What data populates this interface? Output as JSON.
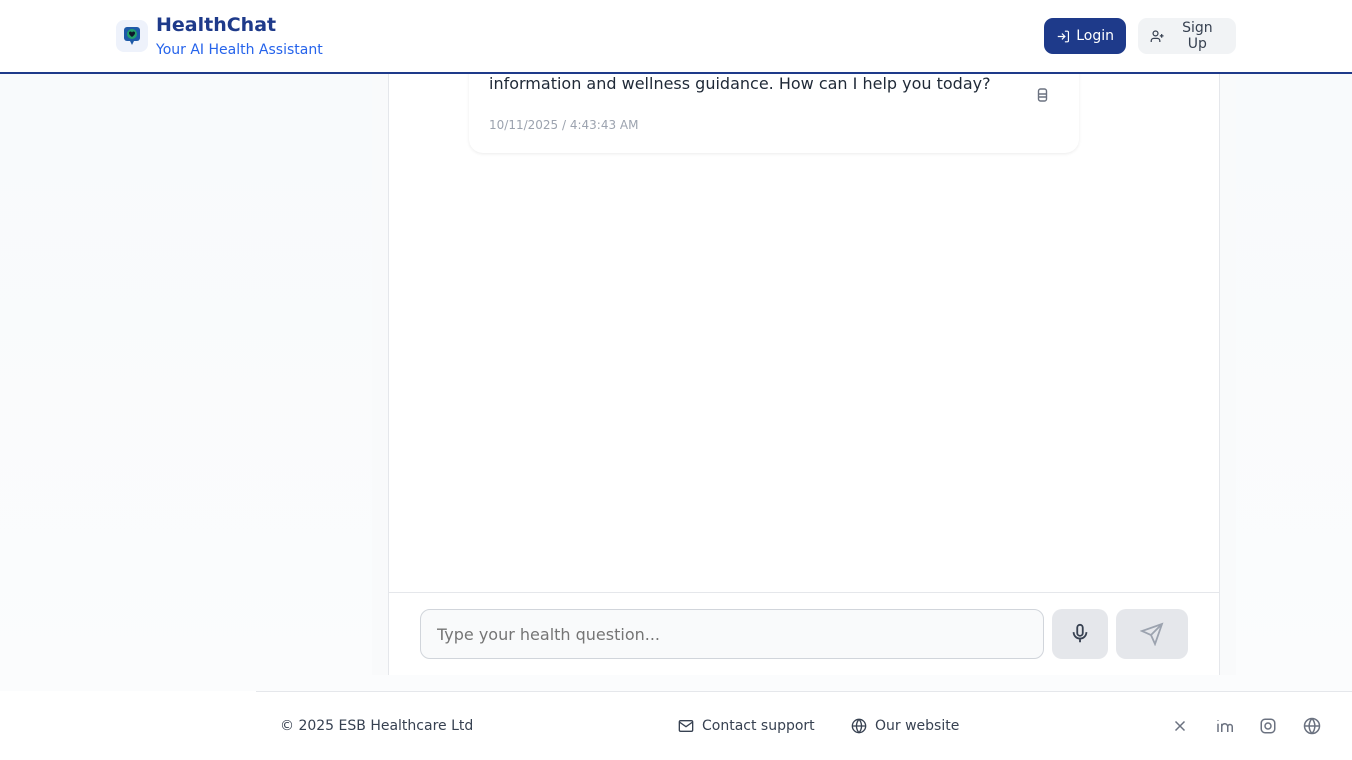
{
  "header": {
    "title": "HealthChat",
    "subtitle": "Your AI Health Assistant",
    "login_label": "Login",
    "signup_label": "Sign Up"
  },
  "chat": {
    "messages": [
      {
        "text": "information and wellness guidance. How can I help you today?",
        "timestamp": "10/11/2025 / 4:43:43 AM"
      }
    ],
    "input_placeholder": "Type your health question..."
  },
  "footer": {
    "copyright": "© 2025 ESB Healthcare Ltd",
    "contact_label": "Contact support",
    "website_label": "Our website",
    "socials": [
      "x-icon",
      "linkedin-icon",
      "instagram-icon",
      "globe-icon"
    ]
  }
}
